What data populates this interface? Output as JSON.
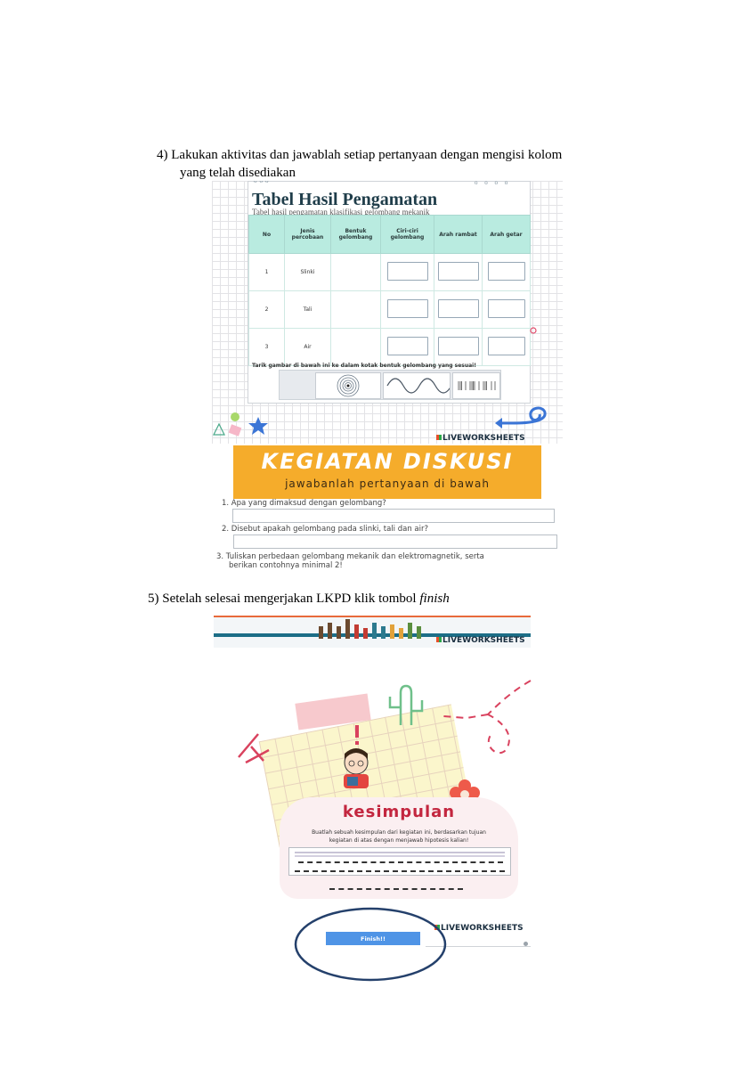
{
  "step4": {
    "line1": "4) Lakukan aktivitas dan jawablah setiap pertanyaan dengan mengisi  kolom",
    "line2": "yang telah disediakan"
  },
  "worksheet": {
    "title": "Tabel Hasil Pengamatan",
    "subtitle": "Tabel hasil pengamatan klasifikasi gelombang mekanik",
    "headers": [
      "No",
      "Jenis percobaan",
      "Bentuk gelombang",
      "Ciri-ciri gelombang",
      "Arah rambat",
      "Arah getar"
    ],
    "rows": [
      {
        "no": "1",
        "jenis": "Slinki"
      },
      {
        "no": "2",
        "jenis": "Tali"
      },
      {
        "no": "3",
        "jenis": "Air"
      }
    ],
    "drag_instruction": "Tarik gambar di bawah ini ke dalam kotak bentuk gelombang yang sesuai!",
    "brand": "LIVEWORKSHEETS"
  },
  "discussion": {
    "title": "KEGIATAN DISKUSI",
    "subtitle": "jawabanlah  pertanyaan di bawah",
    "questions": [
      "1. Apa yang dimaksud dengan gelombang?",
      "2. Disebut apakah gelombang pada slinki, tali dan air?",
      "3. Tuliskan perbedaan gelombang mekanik dan elektromagnetik, serta",
      "berikan  contohnya minimal 2!"
    ]
  },
  "step5": {
    "prefix": "5) Setelah selesai  mengerjakan LKPD klik tombol ",
    "emphasis": "finish"
  },
  "finish_page": {
    "brand": "LIVEWORKSHEETS",
    "title": "kesimpulan",
    "instruction_line1": "Buatlah  sebuah kesimpulan dari kegiatan ini, berdasarkan tujuan",
    "instruction_line2": "kegiatan di atas dengan menjawab hipotesis kalian!",
    "finish_button": "Finish!!",
    "brand_bottom": "LIVEWORKSHEETS"
  },
  "colors": {
    "banner": "#f5ac2b",
    "table_header": "#b9ebe0",
    "kesimpulan_title": "#c3263f",
    "finish_button": "#4f94e6",
    "highlight_ellipse": "#24406b"
  }
}
